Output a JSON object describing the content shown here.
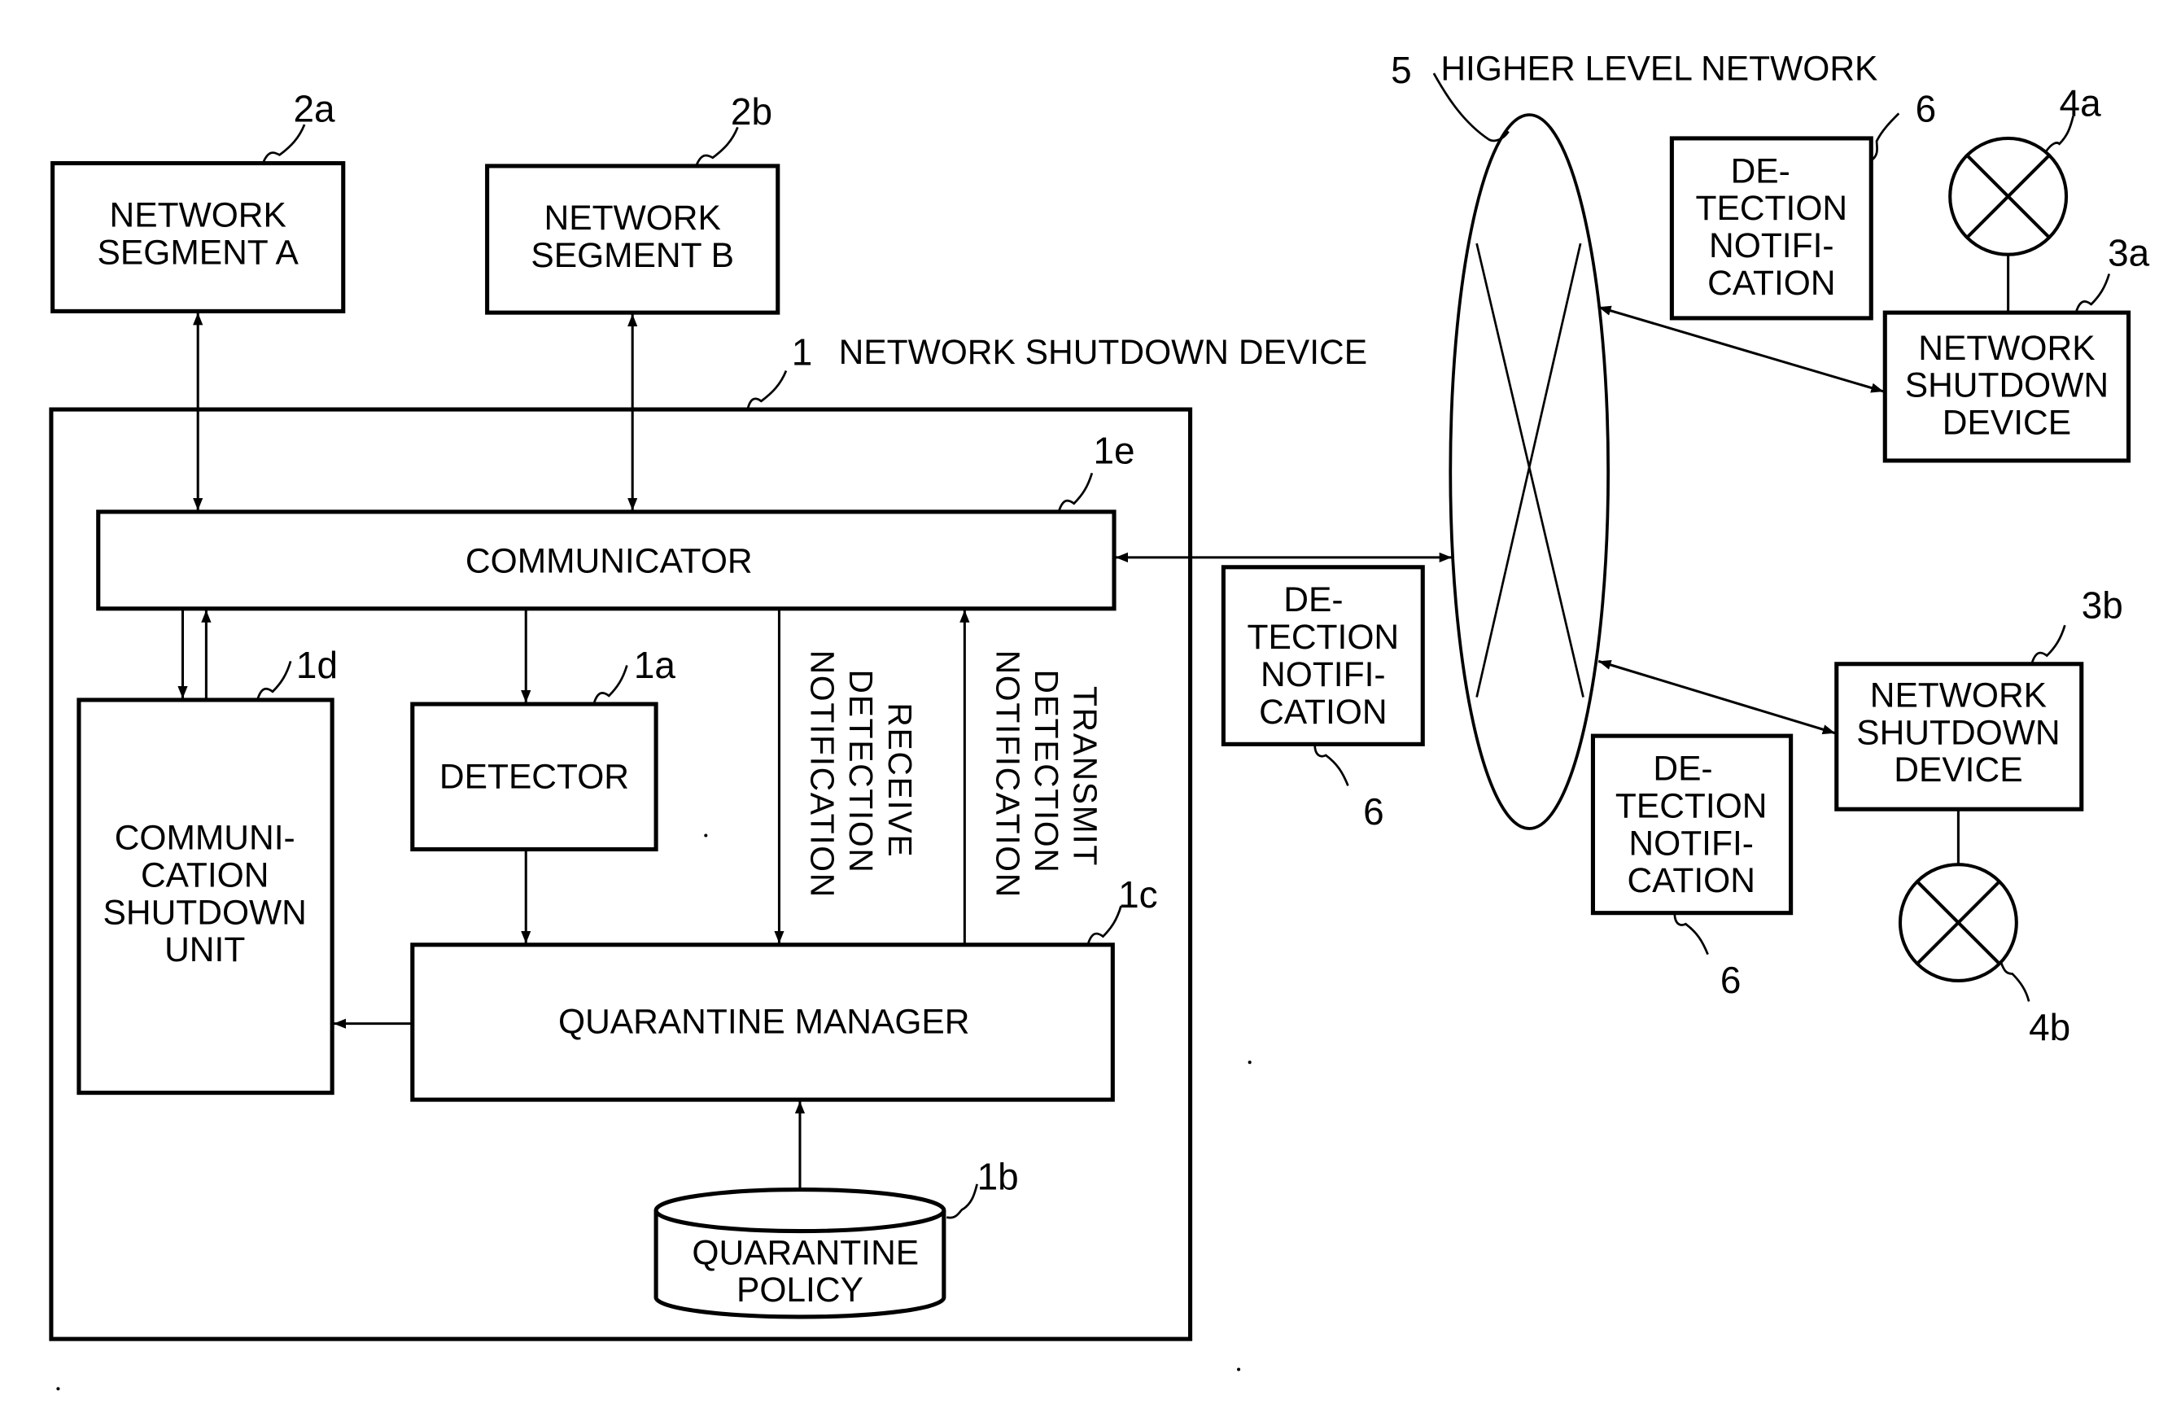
{
  "diagram": {
    "device_title": {
      "ref": "1",
      "text": "NETWORK SHUTDOWN DEVICE"
    },
    "higher_network": {
      "ref": "5",
      "text": "HIGHER LEVEL NETWORK"
    },
    "segment_a": {
      "ref": "2a",
      "lines": [
        "NETWORK",
        "SEGMENT A"
      ]
    },
    "segment_b": {
      "ref": "2b",
      "lines": [
        "NETWORK",
        "SEGMENT B"
      ]
    },
    "communicator": {
      "ref": "1e",
      "text": "COMMUNICATOR"
    },
    "shutdown_unit": {
      "ref": "1d",
      "lines": [
        "COMMUNI-",
        "CATION",
        "SHUTDOWN",
        "UNIT"
      ]
    },
    "detector": {
      "ref": "1a",
      "text": "DETECTOR"
    },
    "quarantine_manager": {
      "ref": "1c",
      "text": "QUARANTINE MANAGER"
    },
    "quarantine_policy": {
      "ref": "1b",
      "lines": [
        "QUARANTINE",
        "POLICY"
      ]
    },
    "receive_notification": {
      "lines": [
        "RECEIVE",
        "DETECTION",
        "NOTIFICATION"
      ]
    },
    "transmit_notification": {
      "lines": [
        "TRANSMIT",
        "DETECTION",
        "NOTIFICATION"
      ]
    },
    "detection_notifications": [
      {
        "ref": "6",
        "lines": [
          "DE-",
          "TECTION",
          "NOTIFI-",
          "CATION"
        ]
      },
      {
        "ref": "6",
        "lines": [
          "DE-",
          "TECTION",
          "NOTIFI-",
          "CATION"
        ]
      },
      {
        "ref": "6",
        "lines": [
          "DE-",
          "TECTION",
          "NOTIFI-",
          "CATION"
        ]
      }
    ],
    "remote_device_a": {
      "ref": "3a",
      "lines": [
        "NETWORK",
        "SHUTDOWN",
        "DEVICE"
      ],
      "terminal_ref": "4a"
    },
    "remote_device_b": {
      "ref": "3b",
      "lines": [
        "NETWORK",
        "SHUTDOWN",
        "DEVICE"
      ],
      "terminal_ref": "4b"
    }
  }
}
